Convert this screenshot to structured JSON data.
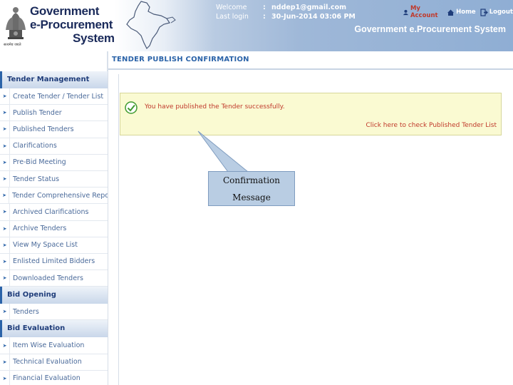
{
  "header": {
    "brand_line1": "Government",
    "brand_line2": "e-Procurement",
    "brand_line3": "System",
    "emblem_caption": "सत्यमेव जयते",
    "welcome_label": "Welcome",
    "welcome_value": "nddep1@gmail.com",
    "last_login_label": "Last login",
    "last_login_value": "30-Jun-2014 03:06 PM",
    "separator": ":",
    "my_account": "My Account",
    "home": "Home",
    "logout": "Logout",
    "system_title": "Government e.Procurement System"
  },
  "page_title": "TENDER PUBLISH CONFIRMATION",
  "sidebar": {
    "tender_management": {
      "title": "Tender Management",
      "items": [
        "Create Tender / Tender List",
        "Publish Tender",
        "Published Tenders",
        "Clarifications",
        "Pre-Bid Meeting",
        "Tender Status",
        "Tender Comprehensive Report",
        "Archived Clarifications",
        "Archive Tenders",
        "View My Space List",
        "Enlisted Limited Bidders",
        "Downloaded Tenders"
      ]
    },
    "bid_opening": {
      "title": "Bid Opening",
      "items": [
        "Tenders"
      ]
    },
    "bid_evaluation": {
      "title": "Bid Evaluation",
      "items": [
        "Item Wise Evaluation",
        "Technical Evaluation",
        "Financial Evaluation"
      ]
    }
  },
  "message": {
    "text": "You have published the Tender successfully.",
    "link": "Click here to check Published Tender List",
    "icon": "check-circle-icon"
  },
  "callout": {
    "line1": "Confirmation",
    "line2": "Message"
  },
  "colors": {
    "accent": "#2b63a8",
    "message_bg": "#fafad2",
    "message_text": "#c0392b",
    "callout_bg": "#b9cde3"
  }
}
